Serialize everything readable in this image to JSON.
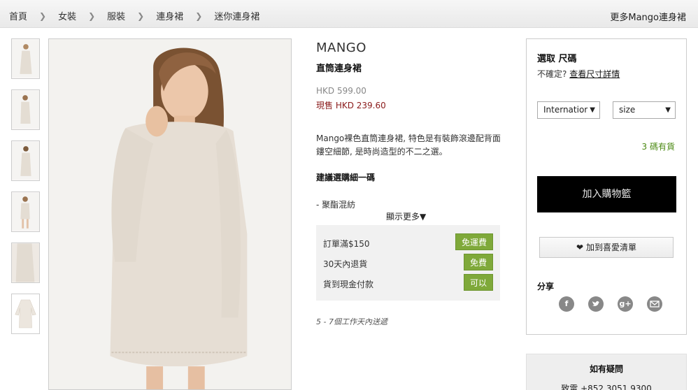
{
  "breadcrumb": {
    "items": [
      "首頁",
      "女裝",
      "服裝",
      "連身裙",
      "迷你連身裙"
    ],
    "more_link": "更多Mango連身裙"
  },
  "product": {
    "brand": "MANGO",
    "name": "直筒連身裙",
    "original_price": "HKD 599.00",
    "sale_price": "現售 HKD 239.60",
    "description": "Mango裸色直筒連身裙, 特色是有裝飾滾邊配背面鏤空細節, 是時尚造型的不二之選。",
    "advice": "建議選購細一碼",
    "material": "- 聚酯混紡",
    "show_more": "顯示更多▼",
    "delivery": "5 - 7個工作天內送遞"
  },
  "perks": [
    {
      "label": "訂單滿$150",
      "badge": "免運費"
    },
    {
      "label": "30天內退貨",
      "badge": "免費"
    },
    {
      "label": "貨到現金付款",
      "badge": "可以"
    }
  ],
  "buybox": {
    "size_title": "選取 尺碼",
    "unsure": "不確定?",
    "size_guide": "查看尺寸詳情",
    "system_select": "Internatior",
    "size_select": "size",
    "stock": "3 碼有貨",
    "add_to_cart": "加入購物籃",
    "wishlist": "加到喜愛清單",
    "share_title": "分享"
  },
  "help": {
    "title": "如有疑問",
    "phone": "致電 +852 3051 9300"
  },
  "colors": {
    "sale": "#8a1a1a",
    "stock": "#4c8a14",
    "badge": "#7fa93a",
    "cart": "#000000"
  },
  "icons": [
    "facebook-icon",
    "twitter-icon",
    "google-plus-icon",
    "email-icon",
    "heart-icon"
  ]
}
